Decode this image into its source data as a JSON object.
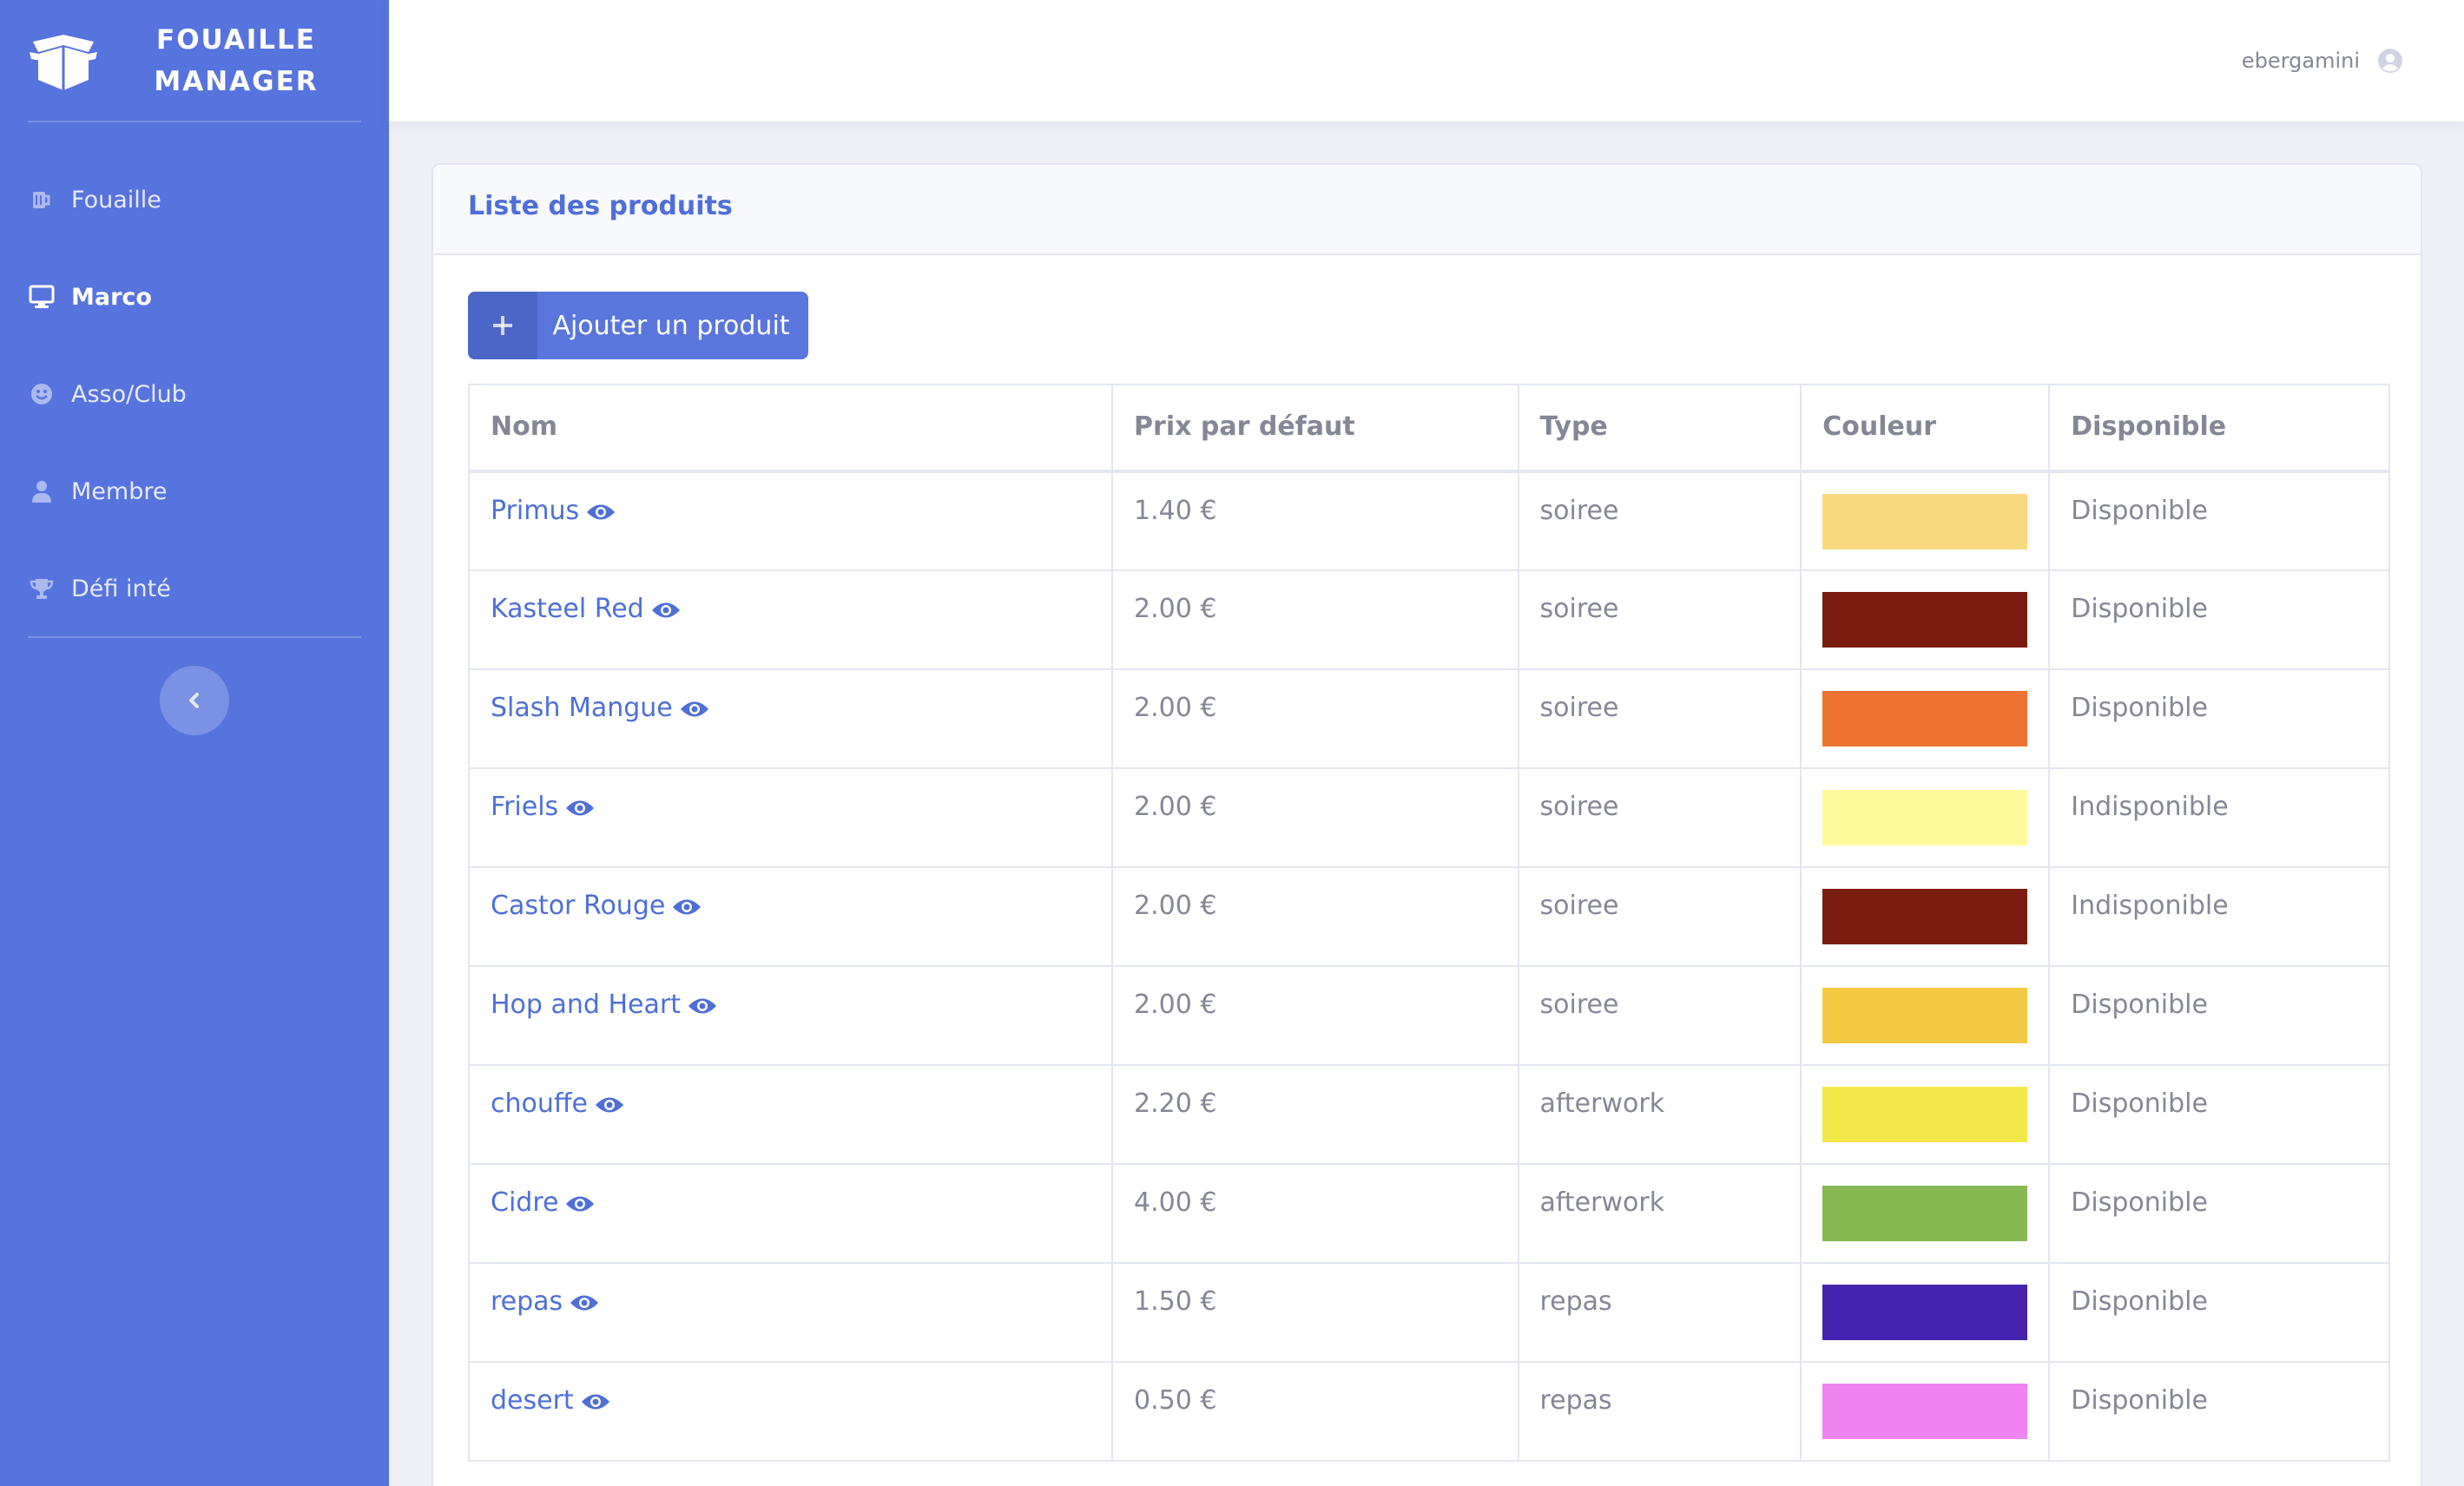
{
  "brand": {
    "line1": "FOUAILLE",
    "line2": "MANAGER",
    "logo_icon": "box-open-icon"
  },
  "sidebar": {
    "items": [
      {
        "label": "Fouaille",
        "icon": "beer-mug-icon",
        "active": false
      },
      {
        "label": "Marco",
        "icon": "desktop-icon",
        "active": true
      },
      {
        "label": "Asso/Club",
        "icon": "smile-icon",
        "active": false
      },
      {
        "label": "Membre",
        "icon": "user-icon",
        "active": false
      },
      {
        "label": "Défi inté",
        "icon": "trophy-icon",
        "active": false
      }
    ],
    "collapse_icon": "chevron-left-icon"
  },
  "topbar": {
    "username": "ebergamini",
    "avatar_icon": "user-circle-icon"
  },
  "card": {
    "title": "Liste des produits",
    "add_button": "Ajouter un produit"
  },
  "table": {
    "headers": [
      "Nom",
      "Prix par défaut",
      "Type",
      "Couleur",
      "Disponible"
    ],
    "rows": [
      {
        "name": "Primus",
        "price": "1.40 €",
        "type": "soiree",
        "color": "#f9d97e",
        "dispo": "Disponible"
      },
      {
        "name": "Kasteel Red",
        "price": "2.00 €",
        "type": "soiree",
        "color": "#7a1c10",
        "dispo": "Disponible"
      },
      {
        "name": "Slash Mangue",
        "price": "2.00 €",
        "type": "soiree",
        "color": "#ee7330",
        "dispo": "Disponible"
      },
      {
        "name": "Friels",
        "price": "2.00 €",
        "type": "soiree",
        "color": "#fef99b",
        "dispo": "Indisponible"
      },
      {
        "name": "Castor Rouge",
        "price": "2.00 €",
        "type": "soiree",
        "color": "#7a1c10",
        "dispo": "Indisponible"
      },
      {
        "name": "Hop and Heart",
        "price": "2.00 €",
        "type": "soiree",
        "color": "#f5c841",
        "dispo": "Disponible"
      },
      {
        "name": "chouffe",
        "price": "2.20 €",
        "type": "afterwork",
        "color": "#f2e84a",
        "dispo": "Disponible"
      },
      {
        "name": "Cidre",
        "price": "4.00 €",
        "type": "afterwork",
        "color": "#88b851",
        "dispo": "Disponible"
      },
      {
        "name": "repas",
        "price": "1.50 €",
        "type": "repas",
        "color": "#4523ae",
        "dispo": "Disponible"
      },
      {
        "name": "desert",
        "price": "0.50 €",
        "type": "repas",
        "color": "#ef84f0",
        "dispo": "Disponible"
      }
    ]
  },
  "colors": {
    "sidebar_bg": "#5773dd",
    "accent": "#4e6fd8",
    "price_green": "#2fb87b"
  }
}
